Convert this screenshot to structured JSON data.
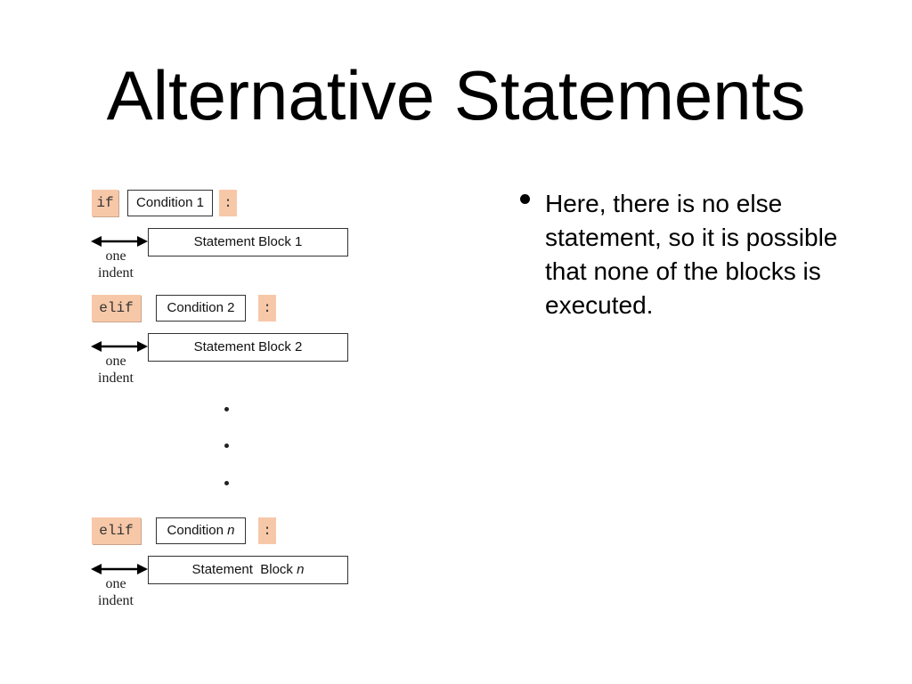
{
  "slide": {
    "title": "Alternative Statements",
    "bullets": [
      "Here, there is no else statement, so it is possible that none of the blocks is executed."
    ]
  },
  "diagram": {
    "indent_label_1": "one",
    "indent_label_2": "indent",
    "colon": ":",
    "rows": [
      {
        "keyword": "if",
        "condition": "Condition 1",
        "block": "Statement  Block 1"
      },
      {
        "keyword": "elif",
        "condition": "Condition 2",
        "block": "Statement  Block 2"
      },
      {
        "keyword": "elif",
        "condition_prefix": "Condition ",
        "condition_var": "n",
        "block_prefix": "Statement  Block ",
        "block_var": "n"
      }
    ],
    "ellipsis": "vertical-dots"
  }
}
